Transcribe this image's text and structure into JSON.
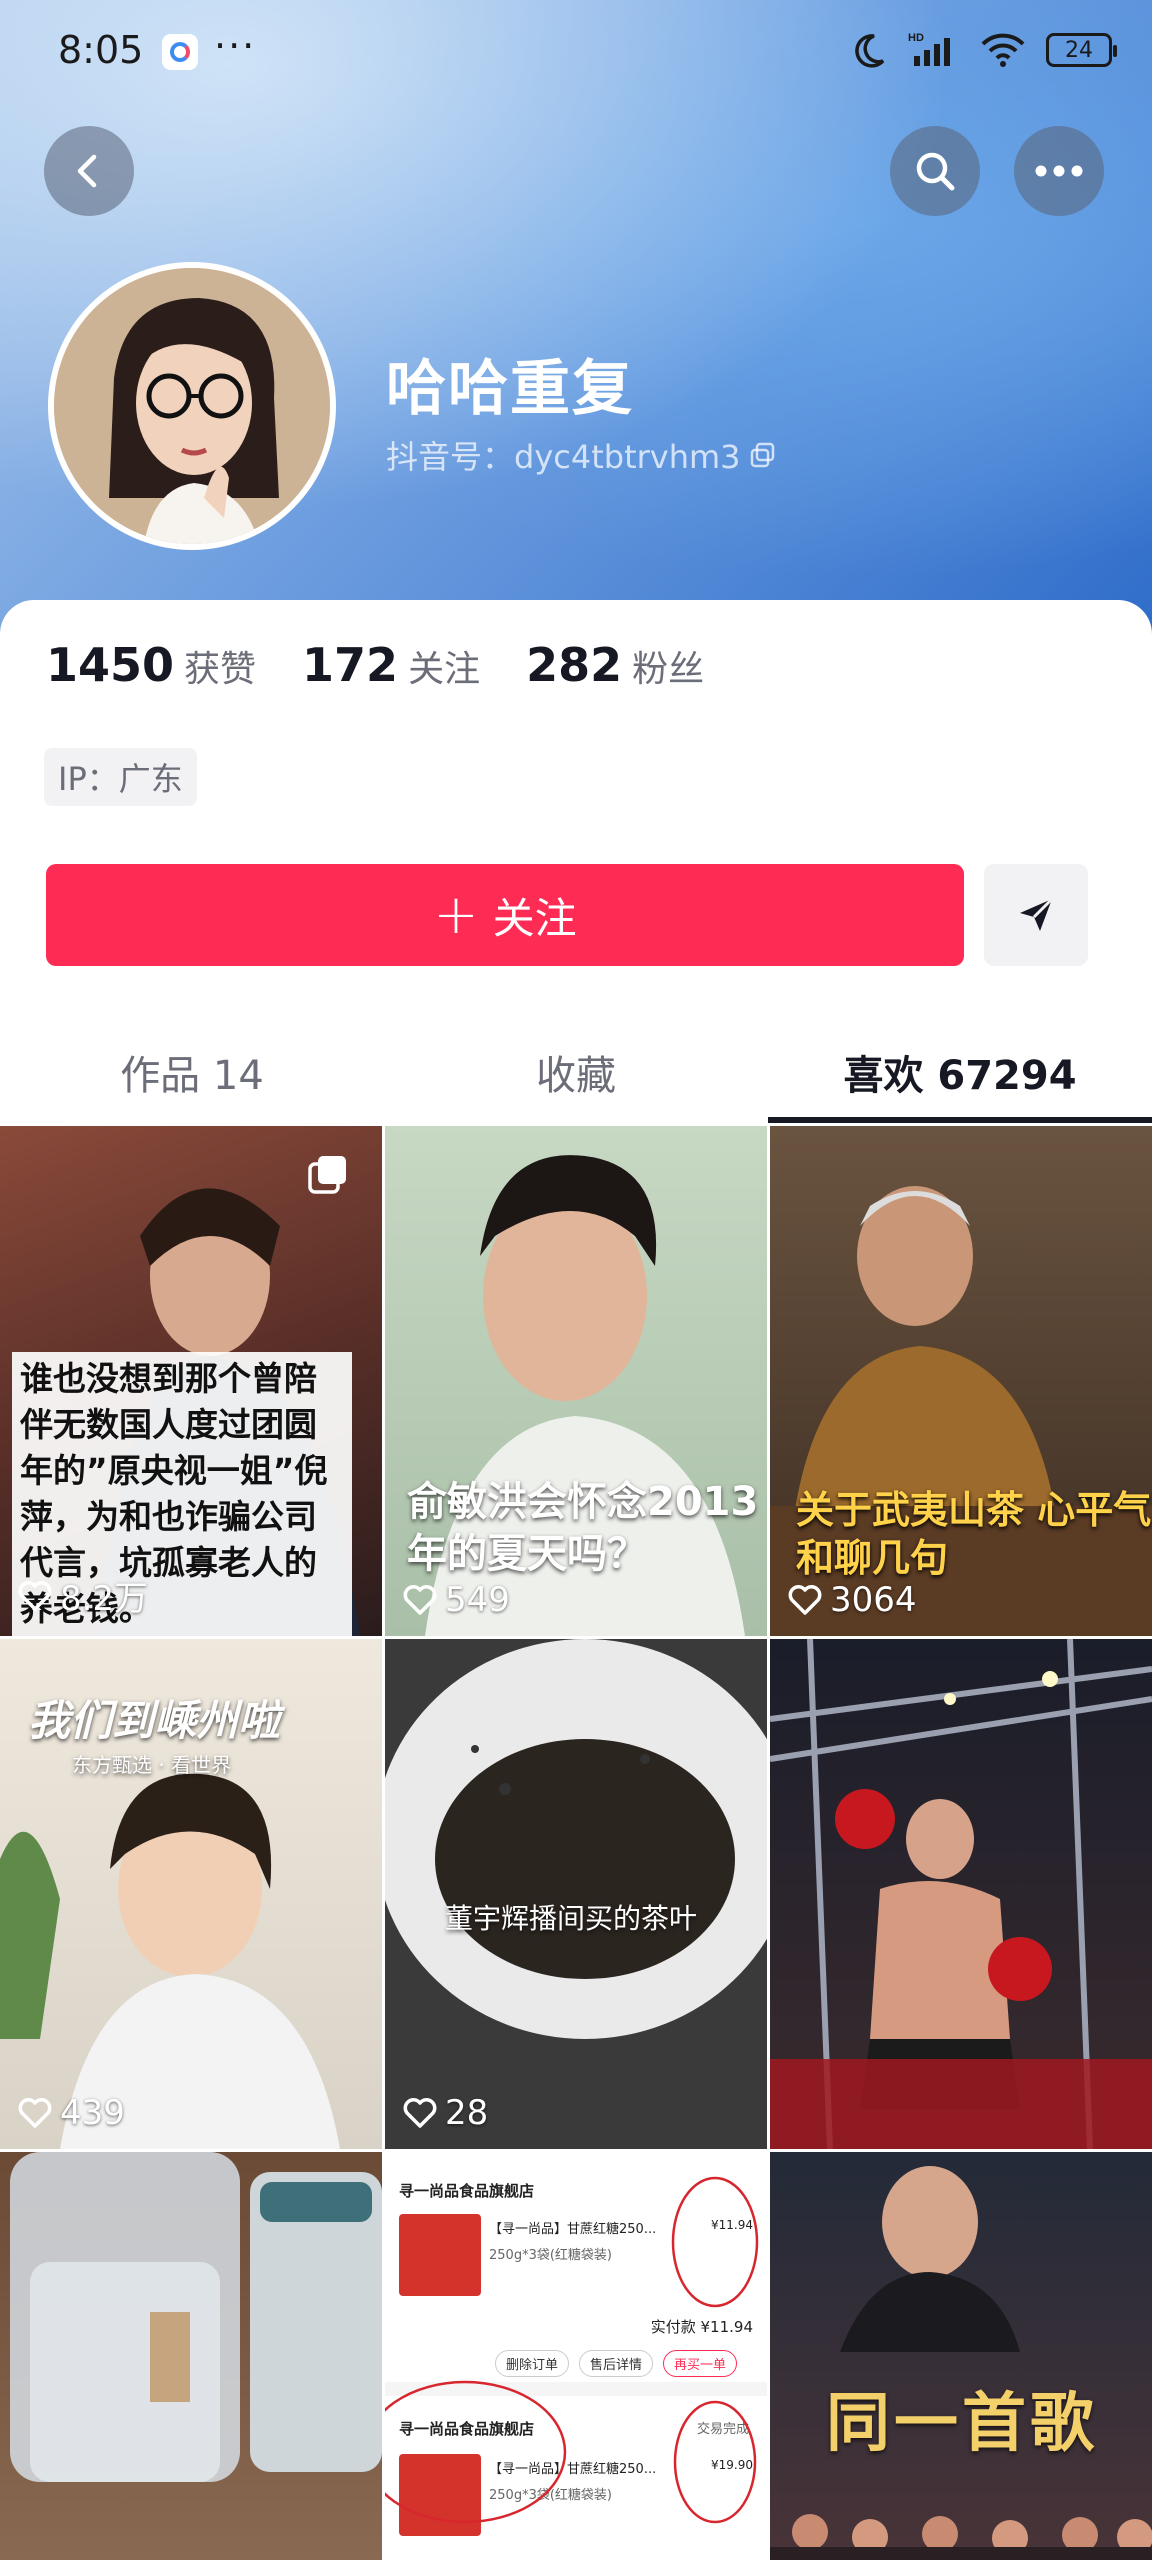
{
  "status_bar": {
    "time": "8:05",
    "more": "···",
    "battery": "24",
    "hd": "HD"
  },
  "profile": {
    "name": "哈哈重复",
    "douyin_id": "抖音号：dyc4tbtrvhm3",
    "stats": [
      {
        "num": "1450",
        "label": "获赞"
      },
      {
        "num": "172",
        "label": "关注"
      },
      {
        "num": "282",
        "label": "粉丝"
      }
    ],
    "ip": "IP：广东"
  },
  "actions": {
    "follow_label": "关注",
    "follow_plus": "+"
  },
  "tabs": [
    {
      "label": "作品 14"
    },
    {
      "label": "收藏"
    },
    {
      "label": "喜欢 67294",
      "active": true
    }
  ],
  "videos": [
    {
      "caption": "谁也没想到那个曾陪伴无数国人度过团圆年的”原央视一姐”倪萍，为和也诈骗公司代言，坑孤寡老人的养老钱。",
      "likes": "8.2万"
    },
    {
      "caption": "俞敏洪会怀念2013年的夏天吗？",
      "likes": "549"
    },
    {
      "caption": "关于武夷山茶 心平气和聊几句",
      "likes": "3064"
    },
    {
      "caption": "我们到嵊州啦",
      "sub": "东方甄选 · 看世界",
      "likes": "439"
    },
    {
      "caption": "董宇辉播间买的茶叶",
      "likes": "28"
    },
    {
      "caption": "",
      "likes": ""
    },
    {
      "caption": "",
      "likes": ""
    },
    {
      "shop": "寻一尚品食品旗舰店",
      "product": "【寻一尚品】甘蔗红糖250...",
      "spec": "250g*3袋(红糖袋装)",
      "price1": "¥11.94",
      "paid": "实付款 ¥11.94",
      "btn1": "删除订单",
      "btn2": "售后详情",
      "btn3": "再买一单",
      "status": "交易完成",
      "price2": "¥19.90"
    },
    {
      "caption": "同一首歌",
      "likes": ""
    }
  ],
  "colors": {
    "accent": "#fe2c55",
    "text": "#161823",
    "muted": "#6b6d78"
  }
}
